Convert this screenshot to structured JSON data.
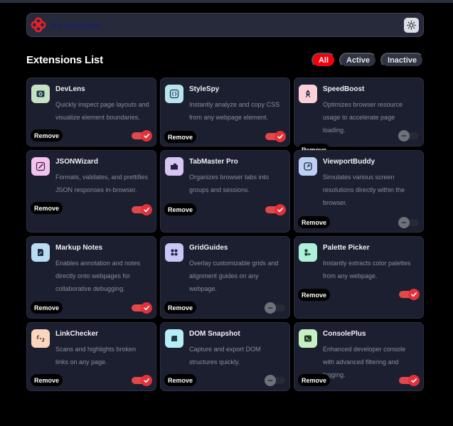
{
  "app": {
    "title": "Extensions",
    "theme_icon": "sun-icon",
    "accent": "#f5000b"
  },
  "list": {
    "title": "Extensions List"
  },
  "filters": [
    {
      "label": "All",
      "selected": true
    },
    {
      "label": "Active",
      "selected": false
    },
    {
      "label": "Inactive",
      "selected": false
    }
  ],
  "remove_label": "Remove",
  "extensions": [
    {
      "name": "DevLens",
      "description": "Quickly inspect page layouts and visualize element boundaries.",
      "enabled": true,
      "icon": "devlens-icon",
      "icon_bg": "#c8e0c4"
    },
    {
      "name": "StyleSpy",
      "description": "Instantly analyze and copy CSS from any webpage element.",
      "enabled": true,
      "icon": "code-braces-icon",
      "icon_bg": "#b9e3ef"
    },
    {
      "name": "SpeedBoost",
      "description": "Optimizes browser resource usage to accelerate page loading.",
      "enabled": false,
      "icon": "rocket-icon",
      "icon_bg": "#fbd0d6"
    },
    {
      "name": "JSONWizard",
      "description": "Formats, validates, and prettifies JSON responses in-browser.",
      "enabled": true,
      "icon": "wand-icon",
      "icon_bg": "#f3c3ee"
    },
    {
      "name": "TabMaster Pro",
      "description": "Organizes browser tabs into groups and sessions.",
      "enabled": true,
      "icon": "tabs-icon",
      "icon_bg": "#d7c6f2"
    },
    {
      "name": "ViewportBuddy",
      "description": "Simulates various screen resolutions directly within the browser.",
      "enabled": false,
      "icon": "viewport-icon",
      "icon_bg": "#bcd0f3"
    },
    {
      "name": "Markup Notes",
      "description": "Enables annotation and notes directly onto webpages for collaborative debugging.",
      "enabled": true,
      "icon": "note-icon",
      "icon_bg": "#b9dcf3"
    },
    {
      "name": "GridGuides",
      "description": "Overlay customizable grids and alignment guides on any webpage.",
      "enabled": false,
      "icon": "grid-icon",
      "icon_bg": "#c8c7f5"
    },
    {
      "name": "Palette Picker",
      "description": "Instantly extracts color palettes from any webpage.",
      "enabled": true,
      "icon": "palette-icon",
      "icon_bg": "#aef0da"
    },
    {
      "name": "LinkChecker",
      "description": "Scans and highlights broken links on any page.",
      "enabled": true,
      "icon": "broken-link-icon",
      "icon_bg": "#fbd6bf"
    },
    {
      "name": "DOM Snapshot",
      "description": "Capture and export DOM structures quickly.",
      "enabled": false,
      "icon": "snapshot-icon",
      "icon_bg": "#b5eef6"
    },
    {
      "name": "ConsolePlus",
      "description": "Enhanced developer console with advanced filtering and logging.",
      "enabled": true,
      "icon": "terminal-icon",
      "icon_bg": "#c6f0c2"
    }
  ]
}
